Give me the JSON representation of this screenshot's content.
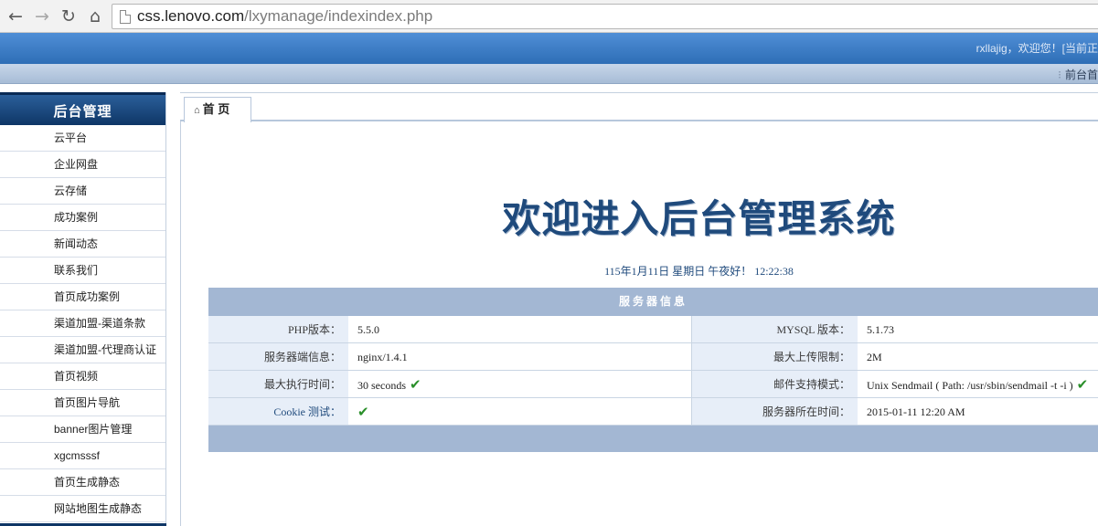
{
  "browser": {
    "url_host": "css.lenovo.com",
    "url_path": "/lxymanage/indexindex.php",
    "back_glyph": "←",
    "forward_glyph": "→",
    "reload_glyph": "↻",
    "home_glyph": "⌂"
  },
  "header": {
    "welcome": "rxllajig，欢迎您！[当前正"
  },
  "subbar": {
    "link": "前台首"
  },
  "sidebar": {
    "title": "后台管理",
    "items": [
      {
        "label": "云平台"
      },
      {
        "label": "企业网盘"
      },
      {
        "label": "云存储"
      },
      {
        "label": "成功案例"
      },
      {
        "label": "新闻动态"
      },
      {
        "label": "联系我们"
      },
      {
        "label": "首页成功案例"
      },
      {
        "label": "渠道加盟-渠道条款"
      },
      {
        "label": "渠道加盟-代理商认证"
      },
      {
        "label": "首页视频"
      },
      {
        "label": "首页图片导航"
      },
      {
        "label": "banner图片管理"
      },
      {
        "label": "xgcmsssf"
      },
      {
        "label": "首页生成静态"
      },
      {
        "label": "网站地图生成静态"
      }
    ]
  },
  "tabs": [
    {
      "label": "首 页",
      "icon": "home-icon"
    }
  ],
  "main": {
    "title": "欢迎进入后台管理系统",
    "datetime": "115年1月11日 星期日 午夜好！ 12:22:38"
  },
  "server_info": {
    "heading": "服务器信息",
    "rows": [
      {
        "label1": "PHP版本：",
        "value1": "5.5.0",
        "check1": false,
        "label2": "MYSQL 版本：",
        "value2": "5.1.73",
        "check2": false
      },
      {
        "label1": "服务器端信息：",
        "value1": "nginx/1.4.1",
        "check1": false,
        "label2": "最大上传限制：",
        "value2": "2M",
        "check2": false
      },
      {
        "label1": "最大执行时间：",
        "value1": "30 seconds",
        "check1": true,
        "label2": "邮件支持模式：",
        "value2": "Unix Sendmail ( Path: /usr/sbin/sendmail -t -i )",
        "check2": true
      },
      {
        "label1": "Cookie 测试：",
        "value1": "",
        "check1": true,
        "label2": "服务器所在时间：",
        "value2": "2015-01-11 12:20 AM",
        "check2": false
      }
    ],
    "check_glyph": "✔"
  },
  "colors": {
    "header_blue": "#3a7cc6",
    "sidebar_title_bg": "#0e3666",
    "title_text": "#1f4a7c",
    "table_head": "#a3b7d3",
    "label_bg": "#e7eef8",
    "check_green": "#2a8f2a"
  }
}
